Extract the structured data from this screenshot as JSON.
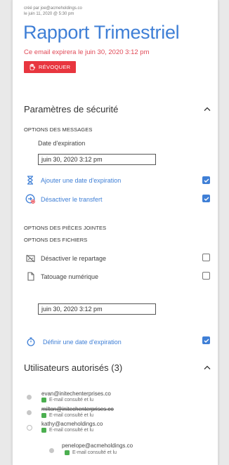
{
  "header": {
    "created_by": "créé par joe@acmeholdings.co",
    "created_on": "le juin 11, 2020 @ 5:30 pm",
    "title": "Rapport Trimestriel",
    "expiry_notice": "Ce email expirera le juin 30, 2020 3:12 pm",
    "revoke_label": "RÉVOQUER"
  },
  "security": {
    "title": "Paramètres de sécurité",
    "message_options_heading": "OPTIONS DES MESSAGES",
    "expiration_label": "Date d'expiration",
    "expiration_value": "juin 30, 2020 3:12 pm",
    "add_expiration_label": "Ajouter une date d'expiration",
    "add_expiration_checked": true,
    "disable_forward_label": "Désactiver le transfert",
    "disable_forward_checked": true,
    "attachment_options_heading": "OPTIONS DES PIÈCES JOINTES",
    "file_options_heading": "OPTIONS DES FICHIERS",
    "disable_sharing_label": "Désactiver le repartage",
    "disable_sharing_checked": false,
    "watermark_label": "Tatouage numérique",
    "watermark_checked": false,
    "file_expiration_value": "juin 30, 2020 3:12 pm",
    "set_expiration_label": "Définir une date d'expiration",
    "set_expiration_checked": true
  },
  "users": {
    "title": "Utilisateurs autorisés (3)",
    "list": [
      {
        "email": "evan@initechenterprises.co",
        "status": "E-mail consulté et lu"
      },
      {
        "email": "milton@initechenterprises.co",
        "status": "E-mail consulté et lu"
      },
      {
        "email": "kathy@acmeholdings.co",
        "status": "E-mail consulté et lu"
      },
      {
        "email": "penelope@acmeholdings.co",
        "status": "E-mail consulté et lu"
      }
    ]
  },
  "colors": {
    "accent": "#3f7fd6",
    "danger": "#e8363f",
    "success": "#4caf50"
  }
}
